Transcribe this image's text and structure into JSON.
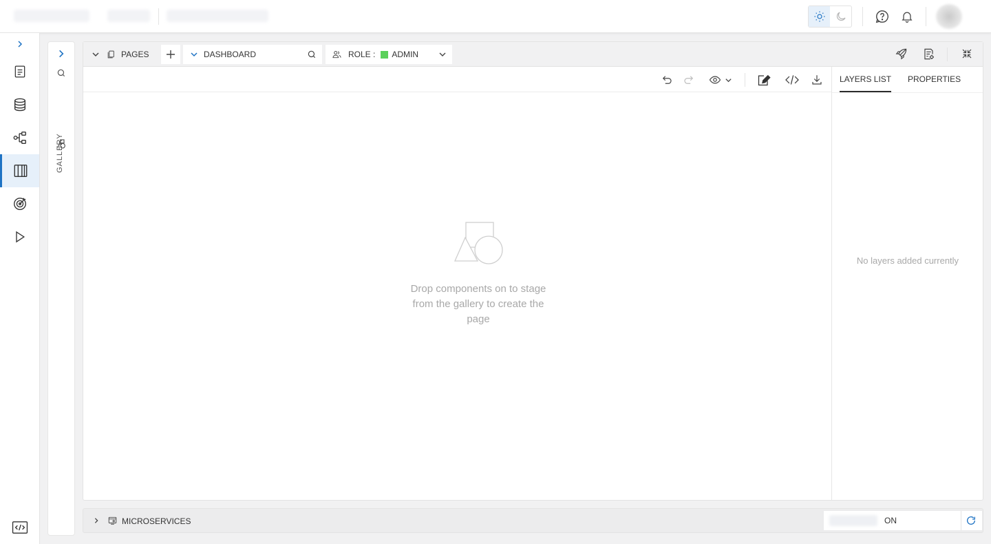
{
  "colors": {
    "accent": "#1f73c4",
    "role_swatch": "#5ad05a"
  },
  "pages": {
    "label": "PAGES",
    "current_page": "DASHBOARD",
    "role_prefix": "ROLE :",
    "role_value": "ADMIN"
  },
  "gallery": {
    "label": "GALLERY"
  },
  "right_panel": {
    "tabs": [
      {
        "label": "LAYERS LIST",
        "active": true
      },
      {
        "label": "PROPERTIES",
        "active": false
      }
    ],
    "empty_text": "No layers added currently"
  },
  "stage": {
    "empty_text": "Drop components on to stage from the gallery to create the page"
  },
  "bottom": {
    "label": "MICROSERVICES",
    "status": "ON"
  },
  "icons": [
    "sun-icon",
    "moon-icon",
    "help-icon",
    "bell-icon",
    "chevron-right-icon",
    "document-icon",
    "database-icon",
    "flow-icon",
    "layout-icon",
    "target-icon",
    "play-icon",
    "code-icon",
    "search-icon",
    "shapes-icon",
    "pages-icon",
    "plus-icon",
    "users-icon",
    "chevron-down-icon",
    "rocket-icon",
    "page-settings-icon",
    "collapse-icon",
    "undo-icon",
    "redo-icon",
    "eye-icon",
    "edit-icon",
    "download-icon",
    "microservices-icon",
    "refresh-icon"
  ]
}
